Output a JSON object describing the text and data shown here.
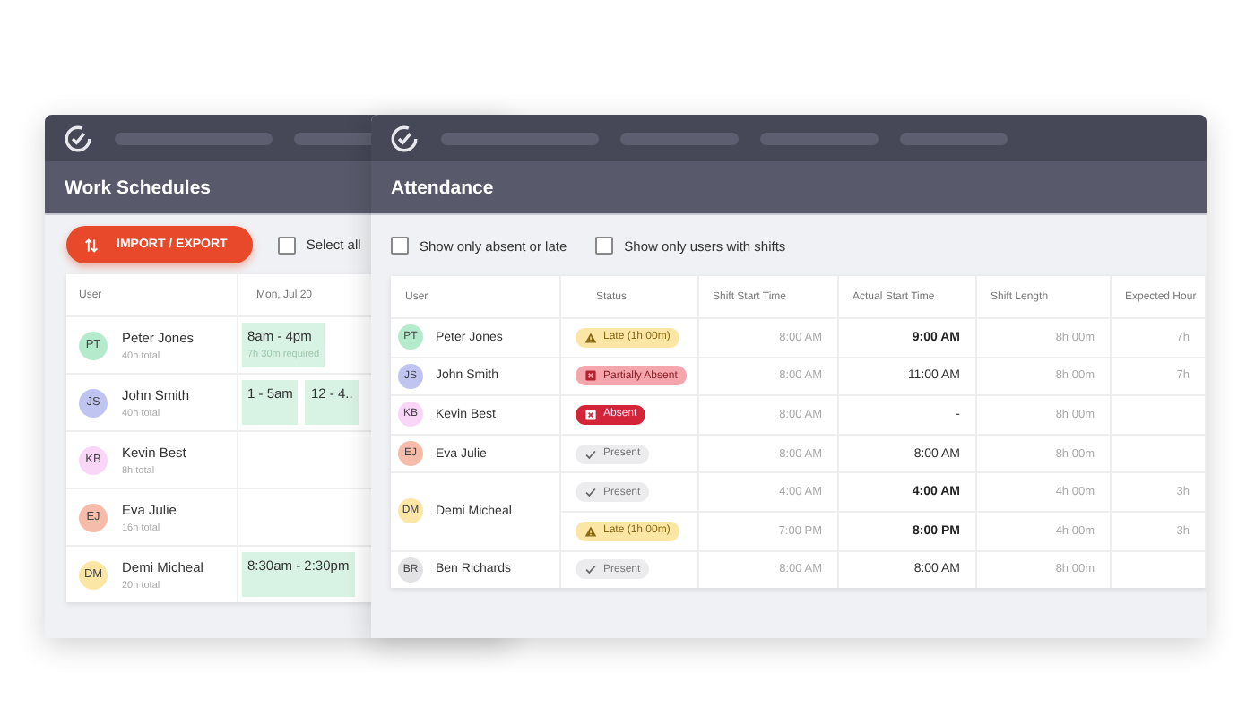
{
  "schedules_window": {
    "title": "Work Schedules",
    "import_button": "IMPORT / EXPORT",
    "select_all": {
      "label": "Select all",
      "checked": false
    },
    "columns": [
      "User",
      "Mon, Jul 20"
    ],
    "rows": [
      {
        "initials": "PT",
        "name": "Peter Jones",
        "total": "40h total",
        "color": "#b5ebcd",
        "shifts": [
          {
            "time": "8am - 4pm",
            "note": "7h 30m required"
          }
        ]
      },
      {
        "initials": "JS",
        "name": "John Smith",
        "total": "40h total",
        "color": "#c0c4f0",
        "shifts": [
          {
            "time": "1 - 5am"
          },
          {
            "time": "12 - 4.."
          }
        ]
      },
      {
        "initials": "KB",
        "name": "Kevin Best",
        "total": "8h total",
        "color": "#f9d6f7",
        "shifts": []
      },
      {
        "initials": "EJ",
        "name": "Eva Julie",
        "total": "16h total",
        "color": "#f5bcaa",
        "shifts": []
      },
      {
        "initials": "DM",
        "name": "Demi Micheal",
        "total": "20h total",
        "color": "#fce6a6",
        "shifts": [
          {
            "time": "8:30am - 2:30pm"
          }
        ]
      }
    ]
  },
  "attendance_window": {
    "title": "Attendance",
    "filters": [
      {
        "label": "Show only absent or late",
        "checked": false
      },
      {
        "label": "Show only users with shifts",
        "checked": false
      }
    ],
    "columns": [
      "User",
      "Status",
      "Shift Start Time",
      "Actual Start Time",
      "Shift Length",
      "Expected Hour"
    ],
    "rows": [
      {
        "initials": "PT",
        "name": "Peter Jones",
        "color": "#b5ebcd",
        "shifts": [
          {
            "status": {
              "kind": "late",
              "label": "Late (1h 00m)"
            },
            "shift_start": "8:00 AM",
            "actual_start": "9:00 AM",
            "emphasized": true,
            "shift_length": "8h 00m",
            "expected_hours": "7h"
          }
        ]
      },
      {
        "initials": "JS",
        "name": "John Smith",
        "color": "#c0c4f0",
        "shifts": [
          {
            "status": {
              "kind": "partial",
              "label": "Partially Absent"
            },
            "shift_start": "8:00 AM",
            "actual_start": "11:00 AM",
            "emphasized": false,
            "shift_length": "8h 00m",
            "expected_hours": "7h"
          }
        ]
      },
      {
        "initials": "KB",
        "name": "Kevin Best",
        "color": "#f9d6f7",
        "shifts": [
          {
            "status": {
              "kind": "absent",
              "label": "Absent"
            },
            "shift_start": "8:00 AM",
            "actual_start": "-",
            "emphasized": false,
            "shift_length": "8h 00m"
          }
        ]
      },
      {
        "initials": "EJ",
        "name": "Eva Julie",
        "color": "#f5bcaa",
        "shifts": [
          {
            "status": {
              "kind": "present",
              "label": "Present"
            },
            "shift_start": "8:00 AM",
            "actual_start": "8:00 AM",
            "emphasized": false,
            "shift_length": "8h 00m"
          }
        ]
      },
      {
        "initials": "DM",
        "name": "Demi Micheal",
        "color": "#fce6a6",
        "shifts": [
          {
            "status": {
              "kind": "present",
              "label": "Present"
            },
            "shift_start": "4:00 AM",
            "actual_start": "4:00 AM",
            "emphasized": true,
            "shift_length": "4h 00m",
            "expected_hours": "3h"
          },
          {
            "status": {
              "kind": "late",
              "label": "Late (1h 00m)"
            },
            "shift_start": "7:00 PM",
            "actual_start": "8:00 PM",
            "emphasized": true,
            "shift_length": "4h 00m",
            "expected_hours": "3h"
          }
        ]
      },
      {
        "initials": "BR",
        "name": "Ben Richards",
        "color": "#e2e2e4",
        "shifts": [
          {
            "status": {
              "kind": "present",
              "label": "Present"
            },
            "shift_start": "8:00 AM",
            "actual_start": "8:00 AM",
            "emphasized": false,
            "shift_length": "8h 00m"
          }
        ]
      }
    ]
  }
}
